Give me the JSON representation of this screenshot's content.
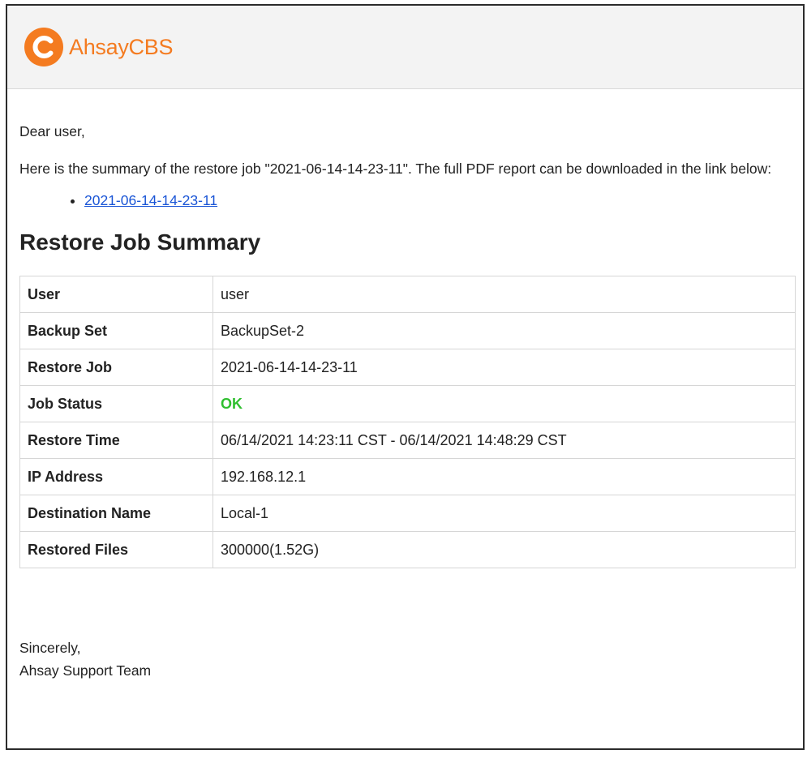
{
  "brand": {
    "name": "AhsayCBS",
    "color": "#f47b20"
  },
  "email": {
    "greeting": "Dear user,",
    "intro": "Here is the summary of the restore job \"2021-06-14-14-23-11\". The full PDF report can be downloaded in the link below:",
    "links": [
      {
        "text": "2021-06-14-14-23-11"
      }
    ],
    "section_title": "Restore Job Summary",
    "summary": [
      {
        "label": "User",
        "value": "user"
      },
      {
        "label": "Backup Set",
        "value": "BackupSet-2"
      },
      {
        "label": "Restore Job",
        "value": "2021-06-14-14-23-11"
      },
      {
        "label": "Job Status",
        "value": "OK",
        "status_color": "#2fbf2f"
      },
      {
        "label": "Restore Time",
        "value": "06/14/2021 14:23:11 CST - 06/14/2021 14:48:29 CST"
      },
      {
        "label": "IP Address",
        "value": "192.168.12.1"
      },
      {
        "label": "Destination Name",
        "value": "Local-1"
      },
      {
        "label": "Restored Files",
        "value": "300000(1.52G)"
      }
    ],
    "closing": "Sincerely,",
    "signature": "Ahsay Support Team"
  },
  "colors": {
    "link": "#1a55d6",
    "header_bg": "#f3f3f3"
  }
}
